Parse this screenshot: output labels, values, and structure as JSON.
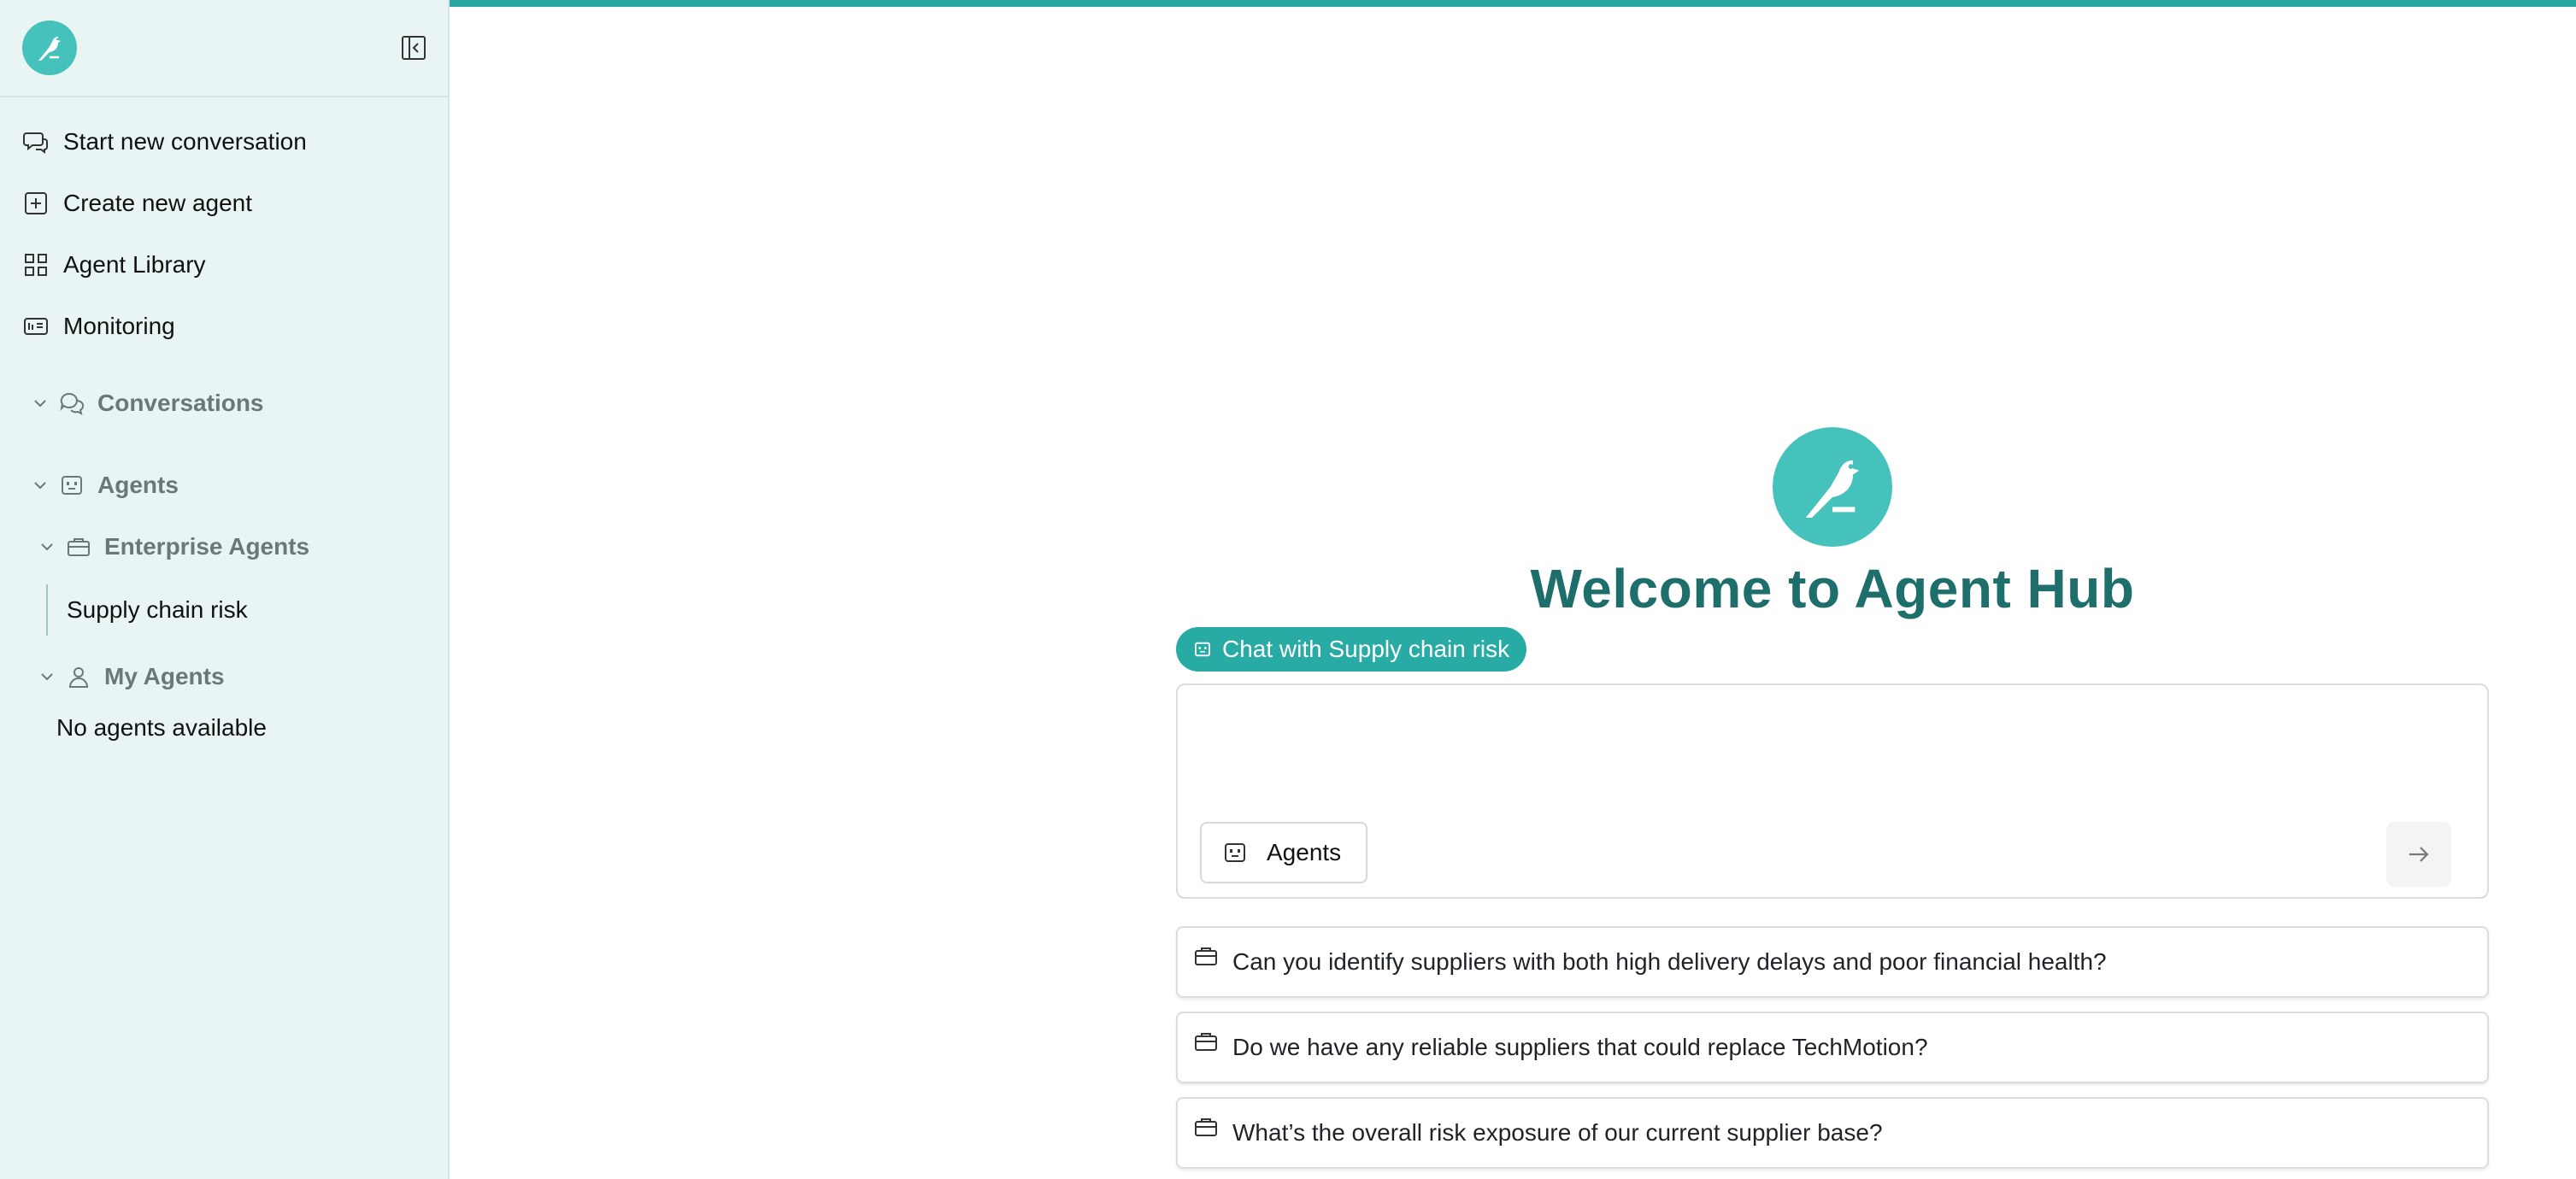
{
  "colors": {
    "accent": "#29aba5",
    "logo": "#46c2bc",
    "heading": "#1e6e6c",
    "sidebar_bg": "#e9f5f5"
  },
  "sidebar": {
    "nav": [
      {
        "label": "Start new conversation",
        "icon": "new-chat-icon"
      },
      {
        "label": "Create new agent",
        "icon": "plus-square-icon"
      },
      {
        "label": "Agent Library",
        "icon": "grid-icon"
      },
      {
        "label": "Monitoring",
        "icon": "monitoring-icon"
      }
    ],
    "sections": {
      "conversations": "Conversations",
      "agents": "Agents",
      "enterprise_agents": "Enterprise Agents",
      "my_agents": "My Agents"
    },
    "enterprise_agent_items": [
      "Supply chain risk"
    ],
    "my_agents_empty": "No agents available"
  },
  "main": {
    "welcome_title": "Welcome to Agent Hub",
    "chip_label": "Chat with Supply chain risk",
    "input_placeholder": "",
    "agents_button_label": "Agents",
    "suggestions": [
      "Can you identify suppliers with both high delivery delays and poor financial health?",
      "Do we have any reliable suppliers that could replace TechMotion?",
      "What’s the overall risk exposure of our current supplier base?"
    ]
  }
}
